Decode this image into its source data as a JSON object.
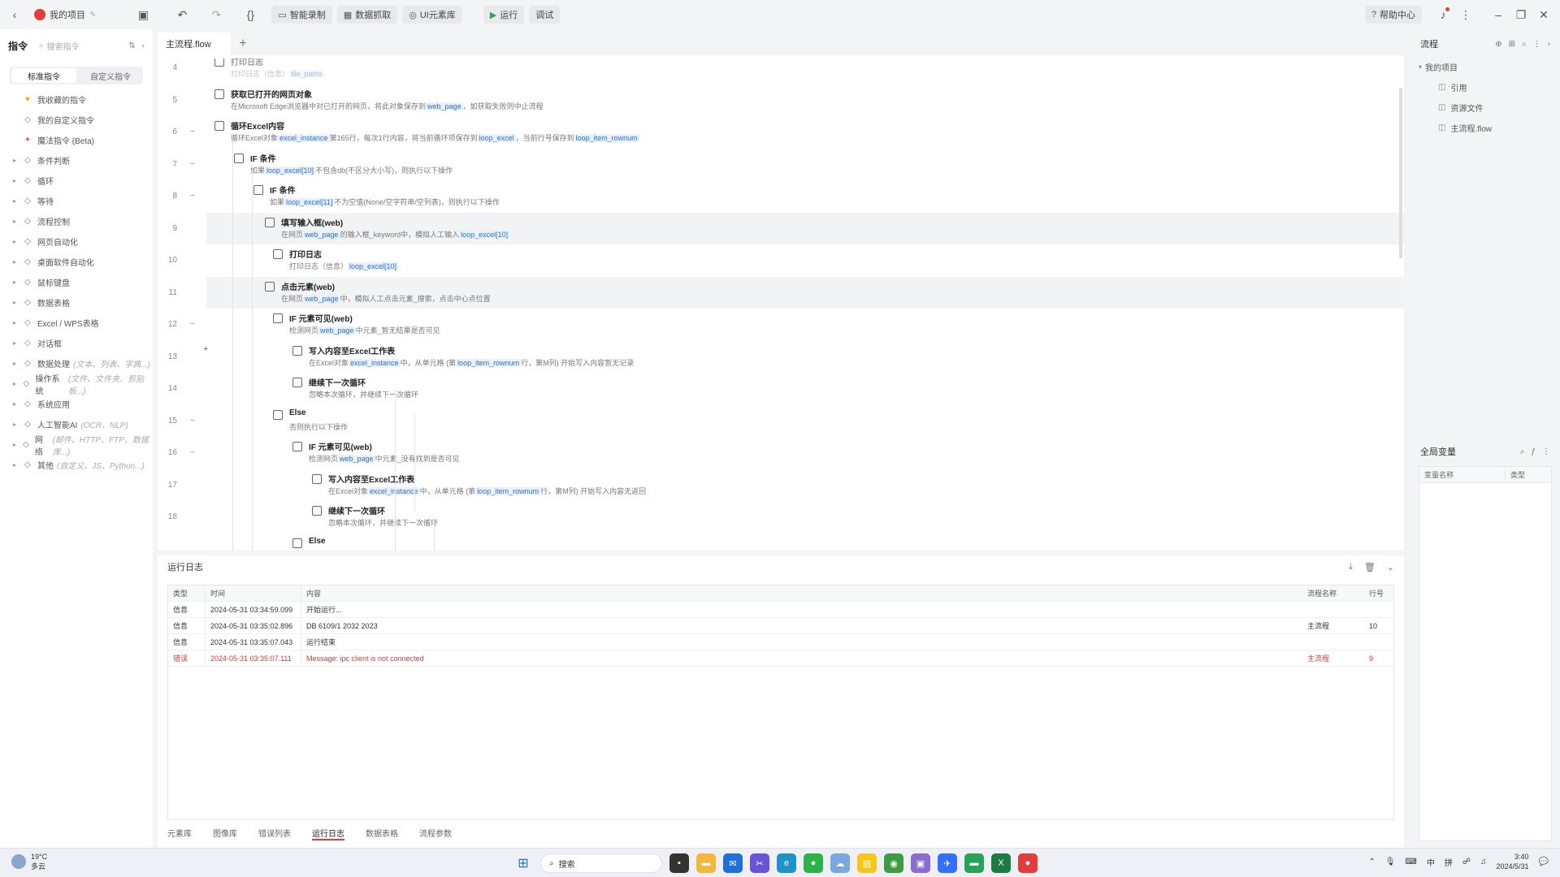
{
  "app": {
    "project_name": "我的项目",
    "file_name": "主流程.flow"
  },
  "toolbar": {
    "smart_record": "智能录制",
    "data_capture": "数据抓取",
    "ui_elements": "UI元素库",
    "run": "运行",
    "debug": "调试",
    "help": "帮助中心"
  },
  "left_panel": {
    "title": "指令",
    "search_placeholder": "搜索指令",
    "tabs": [
      "标准指令",
      "自定义指令"
    ],
    "items": [
      {
        "label": "我收藏的指令",
        "sub": "",
        "icon": "heart-icon",
        "arrow": ""
      },
      {
        "label": "我的自定义指令",
        "sub": "",
        "icon": "custom-icon",
        "arrow": ""
      },
      {
        "label": "魔法指令 (Beta)",
        "sub": "",
        "icon": "magic-icon",
        "arrow": ""
      },
      {
        "label": "条件判断",
        "sub": "",
        "icon": "branch-icon",
        "arrow": "▸"
      },
      {
        "label": "循环",
        "sub": "",
        "icon": "loop-icon",
        "arrow": "▸"
      },
      {
        "label": "等待",
        "sub": "",
        "icon": "hourglass-icon",
        "arrow": "▸"
      },
      {
        "label": "流程控制",
        "sub": "",
        "icon": "flow-icon",
        "arrow": "▸"
      },
      {
        "label": "网页自动化",
        "sub": "",
        "icon": "globe-icon",
        "arrow": "▸"
      },
      {
        "label": "桌面软件自动化",
        "sub": "",
        "icon": "desktop-icon",
        "arrow": "▸"
      },
      {
        "label": "鼠标键盘",
        "sub": "",
        "icon": "mouse-icon",
        "arrow": "▸"
      },
      {
        "label": "数据表格",
        "sub": "",
        "icon": "table-icon",
        "arrow": "▸"
      },
      {
        "label": "Excel / WPS表格",
        "sub": "",
        "icon": "excel-icon",
        "arrow": "▸"
      },
      {
        "label": "对话框",
        "sub": "",
        "icon": "dialog-icon",
        "arrow": "▸"
      },
      {
        "label": "数据处理",
        "sub": "(文本、列表、字典...)",
        "icon": "data-icon",
        "arrow": "▸"
      },
      {
        "label": "操作系统",
        "sub": "(文件、文件夹、剪贴板...)",
        "icon": "os-icon",
        "arrow": "▸"
      },
      {
        "label": "系统应用",
        "sub": "",
        "icon": "app-icon",
        "arrow": "▸"
      },
      {
        "label": "人工智能AI",
        "sub": "(OCR、NLP)",
        "icon": "ai-icon",
        "arrow": "▸"
      },
      {
        "label": "网络",
        "sub": "(邮件、HTTP、FTP、数据库...)",
        "icon": "network-icon",
        "arrow": "▸"
      },
      {
        "label": "其他",
        "sub": "(自定义、JS、Python...)",
        "icon": "more-icon",
        "arrow": "▸"
      }
    ]
  },
  "editor": {
    "rows": [
      {
        "n": "4",
        "fold": "",
        "indent": 0,
        "icon": "log-icon",
        "title": "打印日志",
        "desc": [
          [
            "打印日志（信息）",
            false
          ],
          [
            "file_paths",
            true
          ]
        ],
        "dim": true,
        "hl": false
      },
      {
        "n": "5",
        "fold": "",
        "indent": 0,
        "icon": "browser-icon",
        "title": "获取已打开的网页对象",
        "desc": [
          [
            "在Microsoft Edge浏览器中对已打开的网页，将此对象保存到",
            false
          ],
          [
            "web_page",
            true
          ],
          [
            "，如获取失败则中止流程",
            false
          ]
        ],
        "dim": false,
        "hl": false
      },
      {
        "n": "6",
        "fold": "−",
        "indent": 0,
        "icon": "excel-loop-icon",
        "title": "循环Excel内容",
        "desc": [
          [
            "循环Excel对象",
            false
          ],
          [
            "excel_instance",
            true
          ],
          [
            "第165行，每次1行内容，将当前循环项保存到",
            false
          ],
          [
            "loop_excel",
            true
          ],
          [
            "，当前行号保存到",
            false
          ],
          [
            "loop_item_rownum",
            true
          ]
        ],
        "dim": false,
        "hl": false
      },
      {
        "n": "7",
        "fold": "−",
        "indent": 1,
        "icon": "if-icon",
        "title": "IF 条件",
        "desc": [
          [
            "如果",
            false
          ],
          [
            "loop_excel[10]",
            true
          ],
          [
            "不包含db(不区分大小写)，则执行以下操作",
            false
          ]
        ],
        "dim": false,
        "hl": false
      },
      {
        "n": "8",
        "fold": "−",
        "indent": 2,
        "icon": "if-icon",
        "title": "IF 条件",
        "desc": [
          [
            "如果",
            false
          ],
          [
            "loop_excel[11]",
            true
          ],
          [
            "不为空值(None/空字符串/空列表)，则执行以下操作",
            false
          ]
        ],
        "dim": false,
        "hl": false
      },
      {
        "n": "9",
        "fold": "",
        "indent": 3,
        "icon": "input-icon",
        "title": "填写输入框(web)",
        "desc": [
          [
            "在网页",
            false
          ],
          [
            "web_page",
            true
          ],
          [
            "的输入框_keyword中，模拟人工输入",
            false
          ],
          [
            "loop_excel[10]",
            true
          ]
        ],
        "dim": false,
        "hl": true
      },
      {
        "n": "10",
        "fold": "",
        "indent": 3,
        "icon": "log-icon",
        "title": "打印日志",
        "desc": [
          [
            "打印日志（信息）",
            false
          ],
          [
            "loop_excel[10]",
            true
          ]
        ],
        "dim": false,
        "hl": false
      },
      {
        "n": "11",
        "fold": "",
        "indent": 3,
        "icon": "click-icon",
        "title": "点击元素(web)",
        "desc": [
          [
            "在网页",
            false
          ],
          [
            "web_page",
            true
          ],
          [
            "中，模拟人工点击元素_搜索，点击中心点位置",
            false
          ]
        ],
        "dim": false,
        "hl": true
      },
      {
        "n": "12",
        "fold": "−",
        "indent": 3,
        "icon": "if-visible-icon",
        "title": "IF 元素可见(web)",
        "desc": [
          [
            "检测网页",
            false
          ],
          [
            "web_page",
            true
          ],
          [
            "中元素_暂无结果是否可见",
            false
          ]
        ],
        "dim": false,
        "hl": false
      },
      {
        "n": "13",
        "fold": "",
        "indent": 4,
        "icon": "write-icon",
        "title": "写入内容至Excel工作表",
        "desc": [
          [
            "在Excel对象",
            false
          ],
          [
            "excel_instance",
            true
          ],
          [
            "中，从单元格 (第",
            false
          ],
          [
            "loop_item_rownum",
            true
          ],
          [
            "行，第M列) 开始写入内容暂无记录",
            false
          ]
        ],
        "dim": false,
        "hl": false
      },
      {
        "n": "14",
        "fold": "",
        "indent": 4,
        "icon": "continue-icon",
        "title": "继续下一次循环",
        "desc": [
          [
            "忽略本次循环，并继续下一次循环",
            false
          ]
        ],
        "dim": false,
        "hl": false
      },
      {
        "n": "15",
        "fold": "−",
        "indent": 3,
        "icon": "else-icon",
        "title": "Else",
        "desc": [
          [
            "否则执行以下操作",
            false
          ]
        ],
        "dim": false,
        "hl": false
      },
      {
        "n": "16",
        "fold": "−",
        "indent": 4,
        "icon": "if-visible-icon",
        "title": "IF 元素可见(web)",
        "desc": [
          [
            "检测网页",
            false
          ],
          [
            "web_page",
            true
          ],
          [
            "中元素_没有找到是否可见",
            false
          ]
        ],
        "dim": false,
        "hl": false
      },
      {
        "n": "17",
        "fold": "",
        "indent": 5,
        "icon": "write-icon",
        "title": "写入内容至Excel工作表",
        "desc": [
          [
            "在Excel对象",
            false
          ],
          [
            "excel_instance",
            true
          ],
          [
            "中，从单元格 (第",
            false
          ],
          [
            "loop_item_rownum",
            true
          ],
          [
            "行，第M列) 开始写入内容无返回",
            false
          ]
        ],
        "dim": false,
        "hl": false
      },
      {
        "n": "18",
        "fold": "",
        "indent": 5,
        "icon": "continue-icon",
        "title": "继续下一次循环",
        "desc": [
          [
            "忽略本次循环，并继续下一次循环",
            false
          ]
        ],
        "dim": false,
        "hl": false
      },
      {
        "n": "",
        "fold": "",
        "indent": 4,
        "icon": "else-icon",
        "title": "Else",
        "desc": [],
        "dim": false,
        "hl": false
      }
    ]
  },
  "log": {
    "title": "运行日志",
    "columns": [
      "类型",
      "时间",
      "内容",
      "流程名称",
      "行号"
    ],
    "rows": [
      {
        "type": "信息",
        "time": "2024-05-31 03:34:59.099",
        "content": "开始运行...",
        "flow": "",
        "line": "",
        "error": false
      },
      {
        "type": "信息",
        "time": "2024-05-31 03:35:02.896",
        "content": "DB 6109/1 2032 2023",
        "flow": "主流程",
        "line": "10",
        "error": false
      },
      {
        "type": "信息",
        "time": "2024-05-31 03:35:07.043",
        "content": "运行结束",
        "flow": "",
        "line": "",
        "error": false
      },
      {
        "type": "错误",
        "time": "2024-05-31 03:35:07.111",
        "content": "Message: ipc client is not connected",
        "flow": "主流程",
        "line": "9",
        "error": true
      }
    ],
    "bottom_tabs": [
      "元素库",
      "图像库",
      "错误列表",
      "运行日志",
      "数据表格",
      "流程参数"
    ]
  },
  "right_panel": {
    "title": "流程",
    "tree_root": "我的项目",
    "tree_items": [
      "引用",
      "资源文件",
      "主流程.flow"
    ],
    "vars_title": "全局变量",
    "vars_columns": [
      "变量名称",
      "类型"
    ]
  },
  "taskbar": {
    "weather_temp": "19°C",
    "weather_desc": "多云",
    "search": "搜索",
    "lang": "中",
    "ime": "拼",
    "time": "3:40",
    "date": "2024/5/31"
  }
}
